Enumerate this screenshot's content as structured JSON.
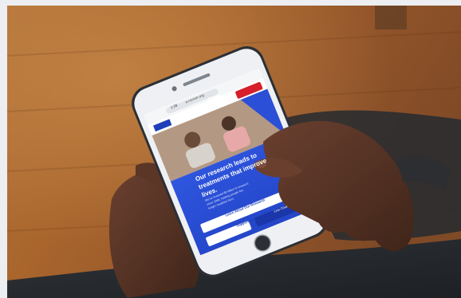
{
  "image": {
    "description": "Close-up photo of a person holding a smartphone with both hands, browsing a charity research website with a blue hero section."
  },
  "phone": {
    "status_time": "1:28",
    "url_text": "a.cancer.org",
    "donate_label": "Donate",
    "hero_headline_lines": [
      "Our research leads to",
      "treatments that improve",
      "lives."
    ],
    "hero_body_lines": [
      "We've invested $5 billion in research",
      "since 1946, helping people live",
      "longer, healthier lives."
    ],
    "learn_button_label": "Learn About Our Research",
    "support_label": "Support Our",
    "live_chat_label": "Live Chat"
  },
  "colors": {
    "background_wood": "#a9682f",
    "phone_frame": "#2c3036",
    "screen_blue": "#2b4fd6",
    "donate_red": "#d71e2b",
    "skin": "#5a3626"
  }
}
